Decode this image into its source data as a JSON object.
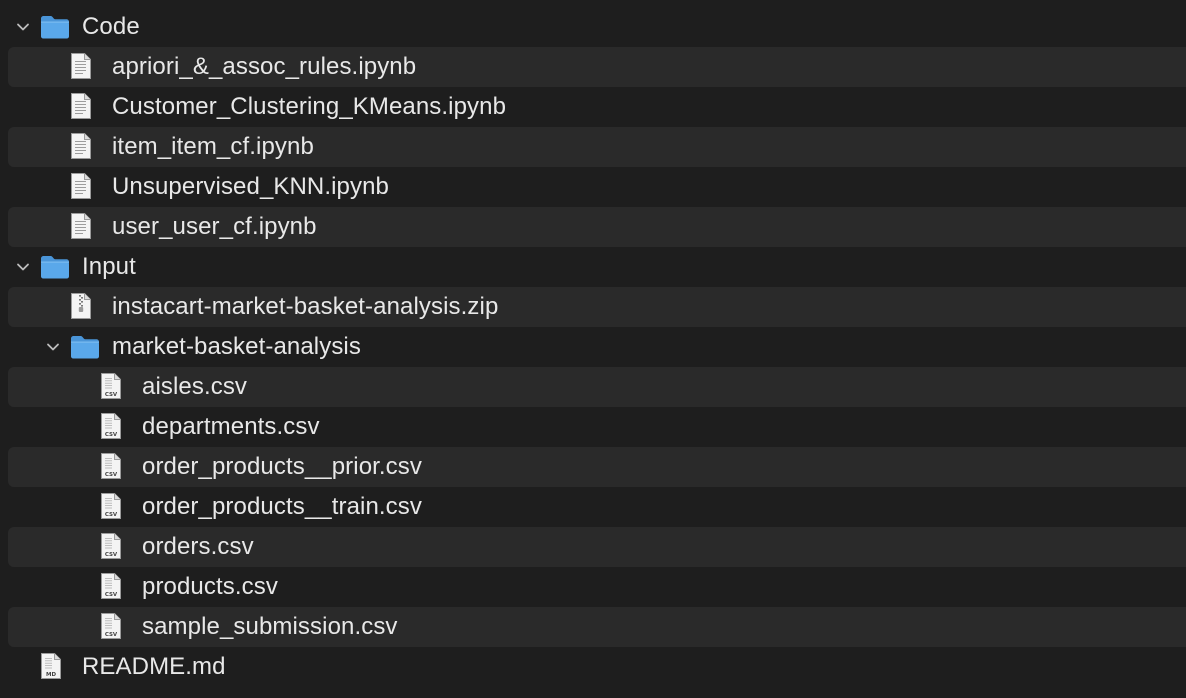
{
  "finder": {
    "rows": [
      {
        "name": "Code",
        "kind": "folder",
        "depth": 0,
        "expanded": true
      },
      {
        "name": "apriori_&_assoc_rules.ipynb",
        "kind": "file",
        "depth": 1
      },
      {
        "name": "Customer_Clustering_KMeans.ipynb",
        "kind": "file",
        "depth": 1
      },
      {
        "name": "item_item_cf.ipynb",
        "kind": "file",
        "depth": 1
      },
      {
        "name": "Unsupervised_KNN.ipynb",
        "kind": "file",
        "depth": 1
      },
      {
        "name": "user_user_cf.ipynb",
        "kind": "file",
        "depth": 1
      },
      {
        "name": "Input",
        "kind": "folder",
        "depth": 0,
        "expanded": true
      },
      {
        "name": "instacart-market-basket-analysis.zip",
        "kind": "zip",
        "depth": 1
      },
      {
        "name": "market-basket-analysis",
        "kind": "folder",
        "depth": 1,
        "expanded": true
      },
      {
        "name": "aisles.csv",
        "kind": "csv",
        "depth": 2,
        "badge": "CSV"
      },
      {
        "name": "departments.csv",
        "kind": "csv",
        "depth": 2,
        "badge": "CSV"
      },
      {
        "name": "order_products__prior.csv",
        "kind": "csv",
        "depth": 2,
        "badge": "CSV"
      },
      {
        "name": "order_products__train.csv",
        "kind": "csv",
        "depth": 2,
        "badge": "CSV"
      },
      {
        "name": "orders.csv",
        "kind": "csv",
        "depth": 2,
        "badge": "CSV"
      },
      {
        "name": "products.csv",
        "kind": "csv",
        "depth": 2,
        "badge": "CSV"
      },
      {
        "name": "sample_submission.csv",
        "kind": "csv",
        "depth": 2,
        "badge": "CSV"
      },
      {
        "name": "README.md",
        "kind": "md",
        "depth": 0,
        "badge": "MD"
      }
    ]
  },
  "colors": {
    "background": "#1e1e1e",
    "row_alt": "#2a2a2a",
    "folder_blue": "#5aa8ea",
    "text": "#e8e8e8"
  },
  "icons": {
    "folder": "folder-icon",
    "file": "document-icon",
    "zip": "zip-archive-icon",
    "csv": "csv-file-icon",
    "md": "markdown-file-icon",
    "chevron": "chevron-down-icon"
  }
}
